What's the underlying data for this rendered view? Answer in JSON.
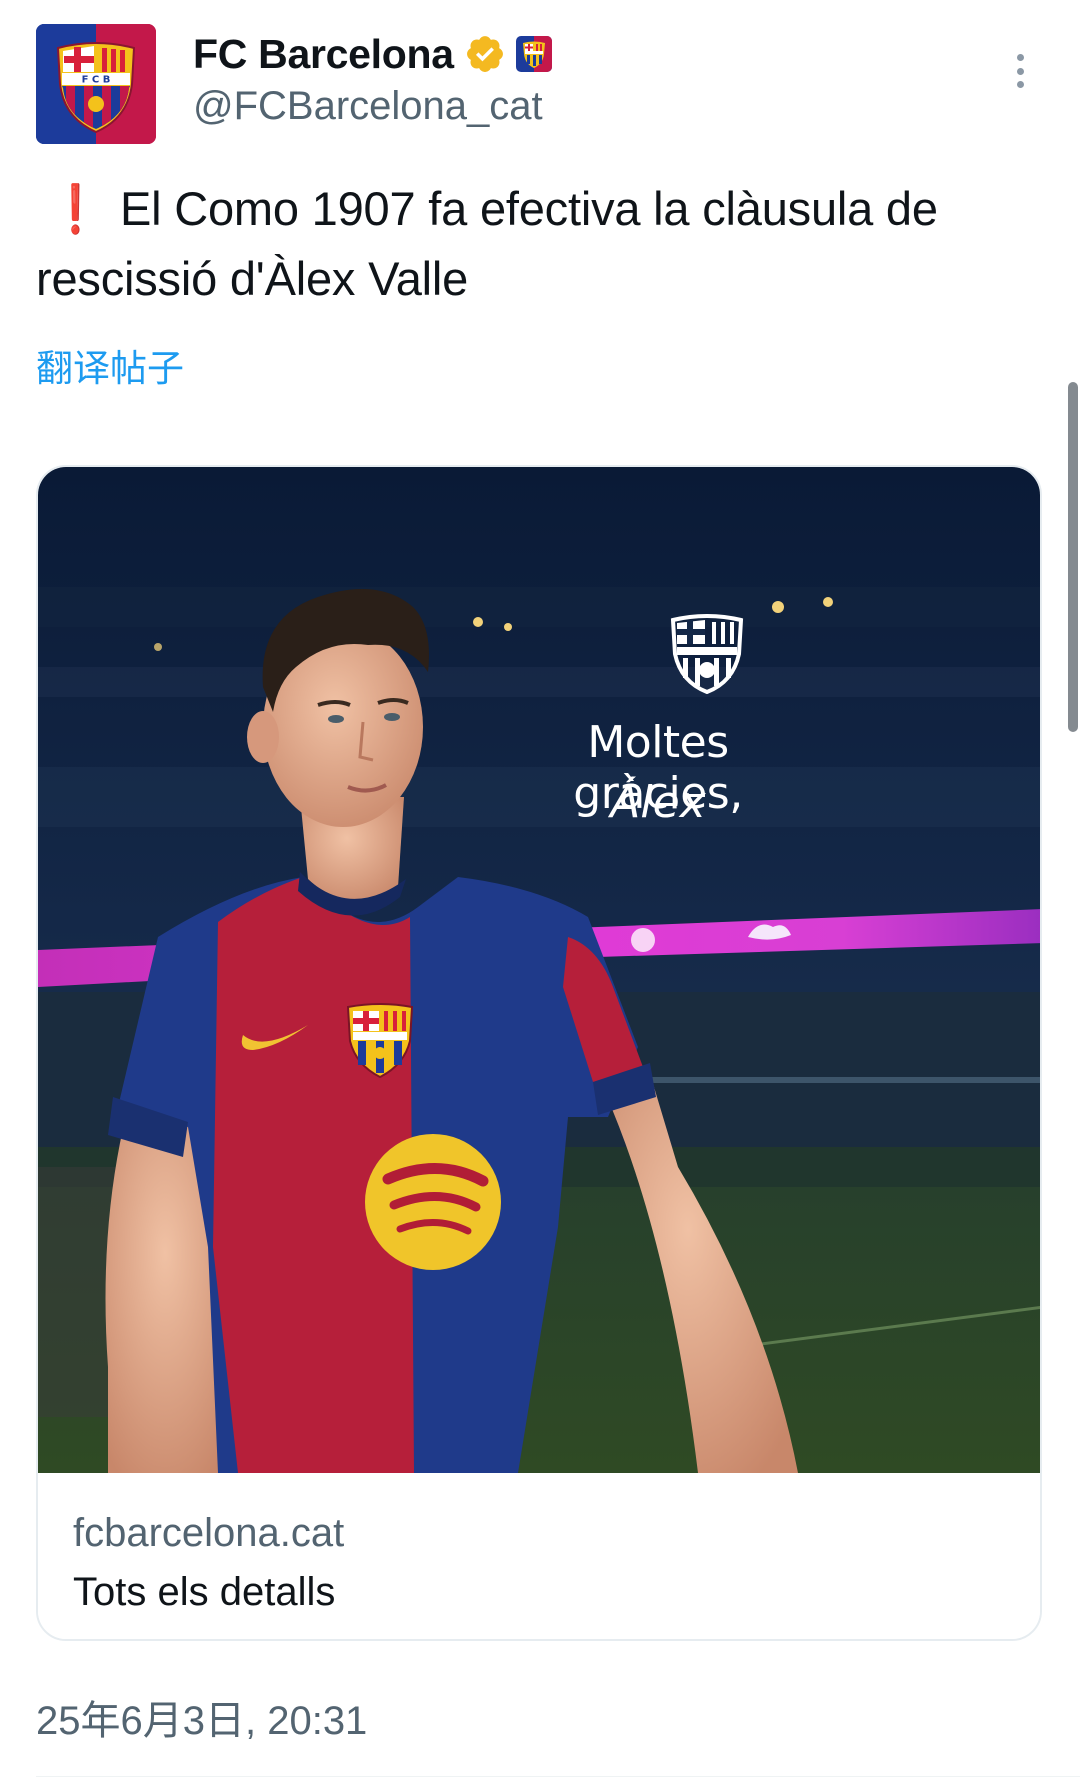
{
  "header": {
    "display_name": "FC Barcelona",
    "handle": "@FCBarcelona_cat",
    "avatar_icon": "fcb-crest-icon",
    "verified_icon": "verified-badge-icon",
    "affiliation_icon": "fcb-affiliate-badge-icon",
    "more_icon": "more-vertical-icon"
  },
  "tweet": {
    "alert_symbol": "❗",
    "text": "El Como 1907 fa efectiva la clàusula de rescissió d'Àlex Valle",
    "translate_label": "翻译帖子"
  },
  "card": {
    "image_text_line1": "Moltes gràcies,",
    "image_text_line2": "Álex",
    "domain": "fcbarcelona.cat",
    "title": "Tots els detalls"
  },
  "timestamp": "25年6月3日, 20:31",
  "colors": {
    "link_blue": "#1d9bf0",
    "alert_red": "#e0143c",
    "verified_gold": "#f4b921",
    "secondary_text": "#536471",
    "barca_blue": "#1c3b9b",
    "barca_red": "#c3184a"
  }
}
